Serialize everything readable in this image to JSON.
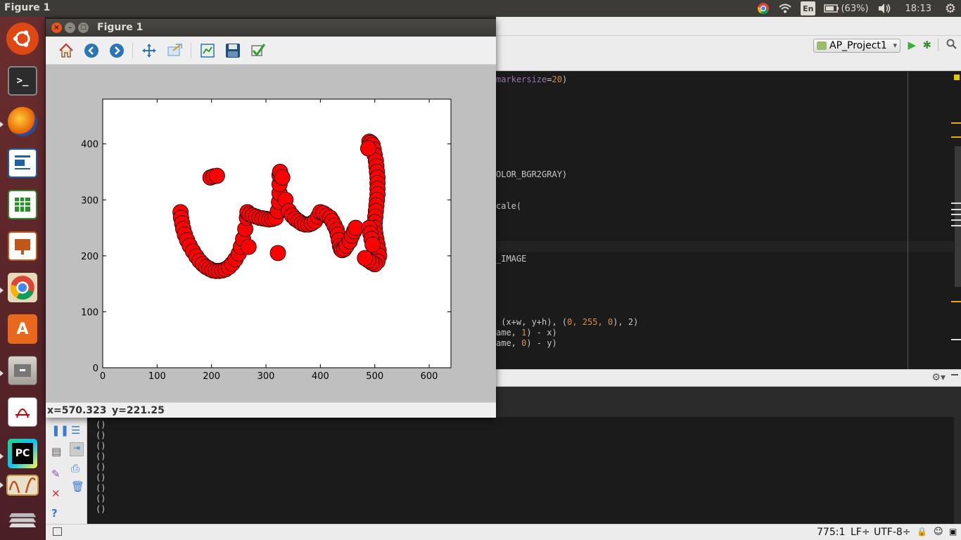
{
  "topbar": {
    "title": "Figure 1",
    "battery": "(63%)",
    "time": "18:13",
    "lang": "En"
  },
  "launcher": {
    "items": [
      {
        "name": "ubuntu-dash-icon"
      },
      {
        "name": "terminal-icon"
      },
      {
        "name": "firefox-icon"
      },
      {
        "name": "libreoffice-writer-icon"
      },
      {
        "name": "libreoffice-calc-icon"
      },
      {
        "name": "libreoffice-impress-icon"
      },
      {
        "name": "chrome-icon"
      },
      {
        "name": "software-center-icon"
      },
      {
        "name": "files-icon"
      },
      {
        "name": "document-viewer-icon"
      },
      {
        "name": "pycharm-icon"
      },
      {
        "name": "matplotlib-figure-icon"
      },
      {
        "name": "workspace-switcher-icon"
      }
    ],
    "pycharm_label": "PC"
  },
  "ide": {
    "project": "AP_Project1",
    "code_lines": [
      {
        "pre": "",
        "kw": "markersize",
        "mid": "=",
        "num": "20",
        "post": ")"
      },
      {
        "pre": "OLOR_BGR2GRAY)",
        "kw": "",
        "mid": "",
        "num": "",
        "post": ""
      },
      {
        "pre": "cale(",
        "kw": "",
        "mid": "",
        "num": "",
        "post": ""
      },
      {
        "pre": "_IMAGE",
        "kw": "",
        "mid": "",
        "num": "",
        "post": ""
      },
      {
        "pre": " (x+w, y+h), (",
        "kw": "",
        "mid": "",
        "num": "0, 255, 0",
        "post": "), 2)"
      },
      {
        "pre": "ame, ",
        "kw": "",
        "mid": "",
        "num": "1",
        "post": ") - x)"
      },
      {
        "pre": "ame, ",
        "kw": "",
        "mid": "",
        "num": "0",
        "post": ") - y)"
      }
    ],
    "console_lines": [
      "()",
      "()",
      "()",
      "()",
      "()",
      "()",
      "()",
      "()",
      "()"
    ],
    "status": {
      "position": "775:1",
      "line_sep": "LF÷",
      "encoding": "UTF-8÷"
    }
  },
  "figure": {
    "window_title": "Figure 1",
    "toolbar": [
      {
        "name": "home-icon"
      },
      {
        "name": "back-icon"
      },
      {
        "name": "forward-icon"
      },
      {
        "name": "pan-icon"
      },
      {
        "name": "zoom-icon"
      },
      {
        "name": "subplots-icon"
      },
      {
        "name": "save-icon"
      },
      {
        "name": "edit-check-icon"
      }
    ],
    "status_x": "x=570.323",
    "status_y": "y=221.25"
  },
  "chart_data": {
    "type": "scatter",
    "title": "",
    "xlabel": "",
    "ylabel": "",
    "xlim": [
      0,
      640
    ],
    "ylim": [
      0,
      480
    ],
    "xticks": [
      0,
      100,
      200,
      300,
      400,
      500,
      600
    ],
    "yticks": [
      0,
      100,
      200,
      300,
      400
    ],
    "marker_color": "#ff0000",
    "marker_edge": "#000000",
    "series": [
      {
        "x": [
          143,
          144,
          146,
          148,
          151,
          155,
          160,
          166,
          172,
          178,
          184,
          190,
          196,
          202,
          208,
          214,
          220,
          226,
          232,
          238,
          244,
          250,
          254,
          258,
          262,
          265
        ],
        "y": [
          278,
          268,
          258,
          248,
          238,
          228,
          218,
          208,
          199,
          191,
          185,
          180,
          177,
          174,
          173,
          173,
          174,
          176,
          180,
          186,
          194,
          204,
          216,
          230,
          248,
          268
        ]
      },
      {
        "x": [
          198,
          204,
          210,
          268,
          322
        ],
        "y": [
          340,
          342,
          343,
          216,
          205
        ]
      },
      {
        "x": [
          266,
          270,
          276,
          282,
          288,
          294,
          300,
          306,
          312,
          318,
          322,
          324,
          325,
          325,
          325,
          326,
          330,
          336,
          342,
          348,
          354,
          360,
          366,
          372,
          378,
          384,
          390,
          396,
          400,
          406,
          412,
          418,
          422,
          426,
          430,
          432,
          434,
          436,
          438,
          440,
          444,
          448,
          454,
          458,
          462,
          465
        ],
        "y": [
          278,
          274,
          272,
          270,
          268,
          267,
          266,
          265,
          266,
          268,
          280,
          296,
          312,
          328,
          344,
          350,
          340,
          300,
          280,
          272,
          266,
          262,
          258,
          256,
          256,
          258,
          262,
          270,
          278,
          276,
          272,
          268,
          262,
          254,
          246,
          238,
          228,
          218,
          212,
          210,
          212,
          218,
          226,
          236,
          244,
          250
        ]
      },
      {
        "x": [
          490,
          493,
          496,
          498,
          500,
          502,
          503,
          504,
          505,
          505,
          505,
          505,
          504,
          503,
          502,
          501,
          500,
          500,
          501,
          503,
          505,
          507,
          508,
          505,
          500,
          494,
          488,
          482
        ],
        "y": [
          404,
          402,
          398,
          390,
          380,
          370,
          360,
          350,
          340,
          330,
          320,
          310,
          300,
          290,
          280,
          270,
          260,
          250,
          240,
          230,
          220,
          210,
          200,
          190,
          185,
          188,
          192,
          196
        ]
      },
      {
        "x": [
          488,
          490,
          492,
          494,
          496
        ],
        "y": [
          392,
          250,
          240,
          230,
          220
        ]
      }
    ]
  }
}
